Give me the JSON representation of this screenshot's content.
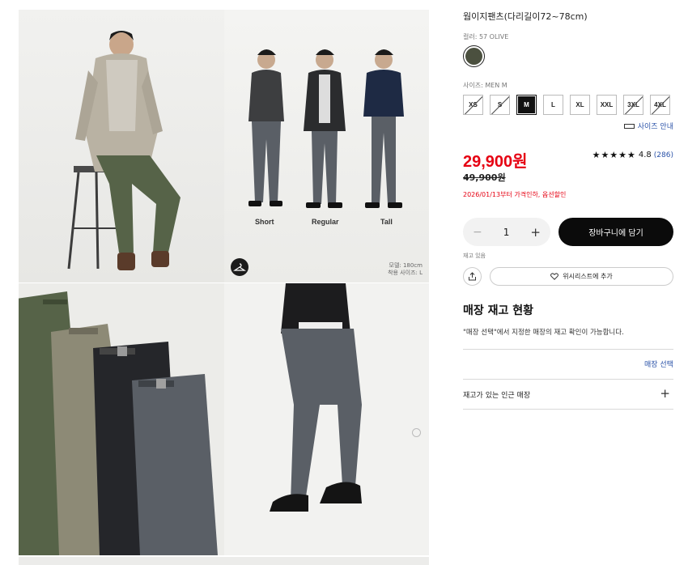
{
  "product": {
    "title": "웜이지팬츠(다리길이72~78cm)",
    "color_label": "컬러: 57 OLIVE",
    "swatch_color": "#4b503f",
    "size_label": "사이즈: MEN M",
    "sizes": [
      {
        "label": "XS",
        "state": "unavailable"
      },
      {
        "label": "S",
        "state": "unavailable"
      },
      {
        "label": "M",
        "state": "selected"
      },
      {
        "label": "L",
        "state": "available"
      },
      {
        "label": "XL",
        "state": "available"
      },
      {
        "label": "XXL",
        "state": "available"
      },
      {
        "label": "3XL",
        "state": "unavailable"
      },
      {
        "label": "4XL",
        "state": "unavailable"
      }
    ],
    "size_guide": "사이즈 안내",
    "price": "29,900원",
    "old_price": "49,900원",
    "rating": {
      "stars": "★★★★★",
      "score": "4.8",
      "count": "(286)",
      "value": 4.8
    },
    "promo": "2026/01/13부터 가격인하,   옵션할인",
    "quantity": "1",
    "minus": "−",
    "plus": "+",
    "add_to_cart": "장바구니에 담기",
    "stock": "재고 있음",
    "wishlist": "위시리스트에 추가"
  },
  "store": {
    "heading": "매장 재고 현황",
    "description": "\"매장 선택\"에서 지정한 매장의 재고 확인이 가능합니다.",
    "select_label": "매장 선택",
    "nearby_label": "재고가 있는 인근 매장",
    "nearby_toggle": "+"
  },
  "gallery": {
    "fit_captions": [
      "Short",
      "Regular",
      "Tall"
    ],
    "model_info": [
      "모델: 180cm",
      "착용 사이즈: L"
    ]
  },
  "colors": {
    "accent_red": "#e60012",
    "link_blue": "#2a52a8",
    "olive": "#566348",
    "khaki": "#8d8a76",
    "black": "#25262a",
    "gray": "#5a5f66"
  }
}
